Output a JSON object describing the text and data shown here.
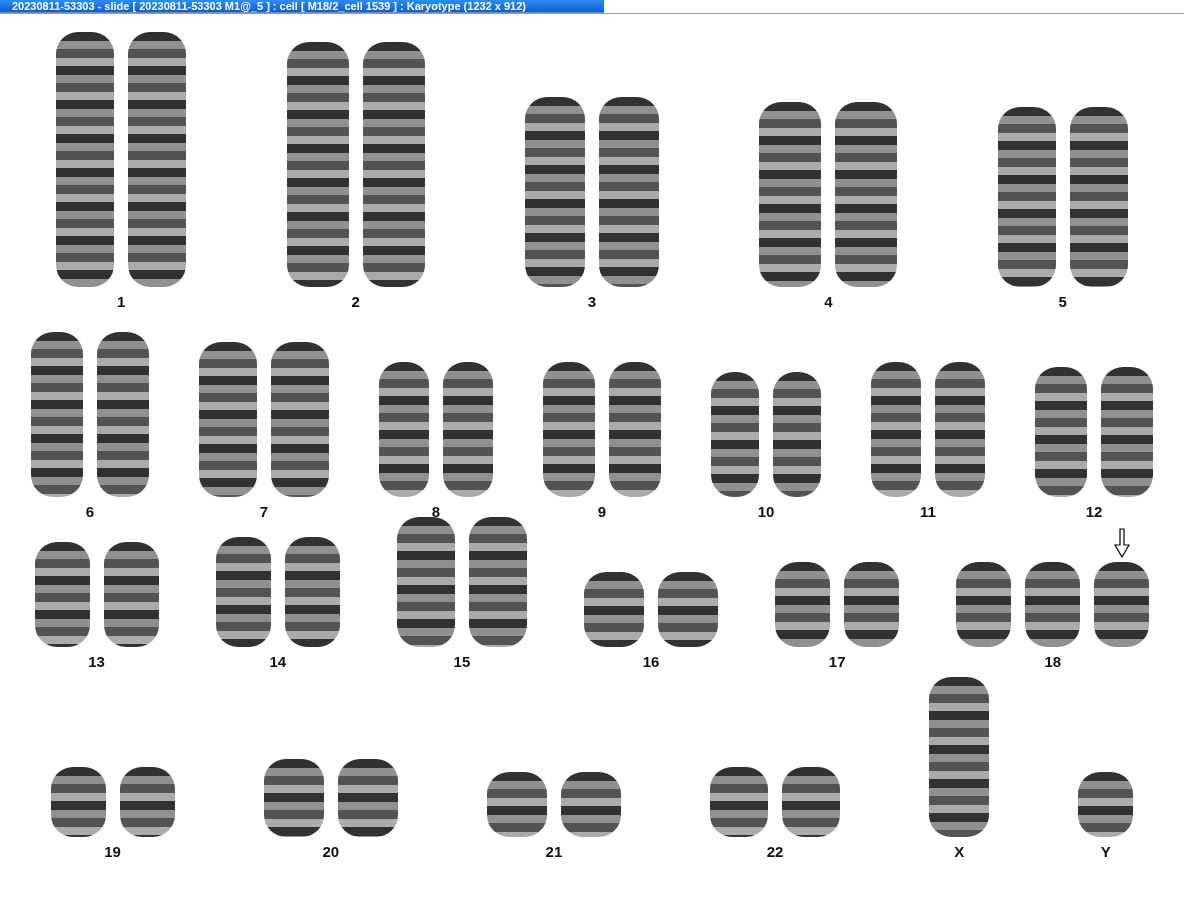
{
  "window": {
    "title": "20230811-53303 - slide [ 20230811-53303 M1@_5 ] : cell [ M18/2_cell 1539 ] : Karyotype  (1232 x 912)"
  },
  "rows": [
    {
      "groups": [
        {
          "label": "1",
          "chromosomes": [
            {
              "kind": "plain"
            },
            {
              "kind": "plain"
            }
          ]
        },
        {
          "label": "2",
          "chromosomes": [
            {
              "kind": "plain"
            },
            {
              "kind": "plain"
            }
          ]
        },
        {
          "label": "3",
          "chromosomes": [
            {
              "kind": "plain"
            },
            {
              "kind": "plain"
            }
          ]
        },
        {
          "label": "4",
          "chromosomes": [
            {
              "kind": "plain"
            },
            {
              "kind": "plain"
            }
          ]
        },
        {
          "label": "5",
          "chromosomes": [
            {
              "kind": "plain"
            },
            {
              "kind": "plain"
            }
          ]
        }
      ]
    },
    {
      "groups": [
        {
          "label": "6",
          "chromosomes": [
            {
              "kind": "plain"
            },
            {
              "kind": "plain"
            }
          ]
        },
        {
          "label": "7",
          "chromosomes": [
            {
              "kind": "plain"
            },
            {
              "kind": "plain"
            }
          ]
        },
        {
          "label": "8",
          "chromosomes": [
            {
              "kind": "plain"
            },
            {
              "kind": "plain"
            }
          ]
        },
        {
          "label": "9",
          "chromosomes": [
            {
              "kind": "plain"
            },
            {
              "kind": "plain"
            }
          ]
        },
        {
          "label": "10",
          "chromosomes": [
            {
              "kind": "plain"
            },
            {
              "kind": "plain"
            }
          ]
        },
        {
          "label": "11",
          "chromosomes": [
            {
              "kind": "plain"
            },
            {
              "kind": "plain"
            }
          ]
        },
        {
          "label": "12",
          "chromosomes": [
            {
              "kind": "plain"
            },
            {
              "kind": "plain"
            }
          ]
        }
      ]
    },
    {
      "groups": [
        {
          "label": "13",
          "chromosomes": [
            {
              "kind": "plain"
            },
            {
              "kind": "plain"
            }
          ]
        },
        {
          "label": "14",
          "chromosomes": [
            {
              "kind": "plain"
            },
            {
              "kind": "plain"
            }
          ]
        },
        {
          "label": "15",
          "chromosomes": [
            {
              "kind": "plain"
            },
            {
              "kind": "plain"
            }
          ]
        },
        {
          "label": "16",
          "chromosomes": [
            {
              "kind": "plain"
            },
            {
              "kind": "plain"
            }
          ]
        },
        {
          "label": "17",
          "chromosomes": [
            {
              "kind": "plain"
            },
            {
              "kind": "plain"
            }
          ]
        },
        {
          "label": "18",
          "chromosomes": [
            {
              "kind": "plain"
            },
            {
              "kind": "plain"
            },
            {
              "kind": "flagged"
            }
          ]
        }
      ]
    },
    {
      "groups": [
        {
          "label": "19",
          "chromosomes": [
            {
              "kind": "plain"
            },
            {
              "kind": "plain"
            }
          ]
        },
        {
          "label": "20",
          "chromosomes": [
            {
              "kind": "plain"
            },
            {
              "kind": "plain"
            }
          ]
        },
        {
          "label": "21",
          "chromosomes": [
            {
              "kind": "plain"
            },
            {
              "kind": "plain"
            }
          ]
        },
        {
          "label": "22",
          "chromosomes": [
            {
              "kind": "plain"
            },
            {
              "kind": "plain"
            }
          ]
        },
        {
          "label": "X",
          "chromosomes": [
            {
              "kind": "plain"
            }
          ]
        },
        {
          "label": "Y",
          "chromosomes": [
            {
              "kind": "plain"
            }
          ]
        }
      ]
    }
  ]
}
